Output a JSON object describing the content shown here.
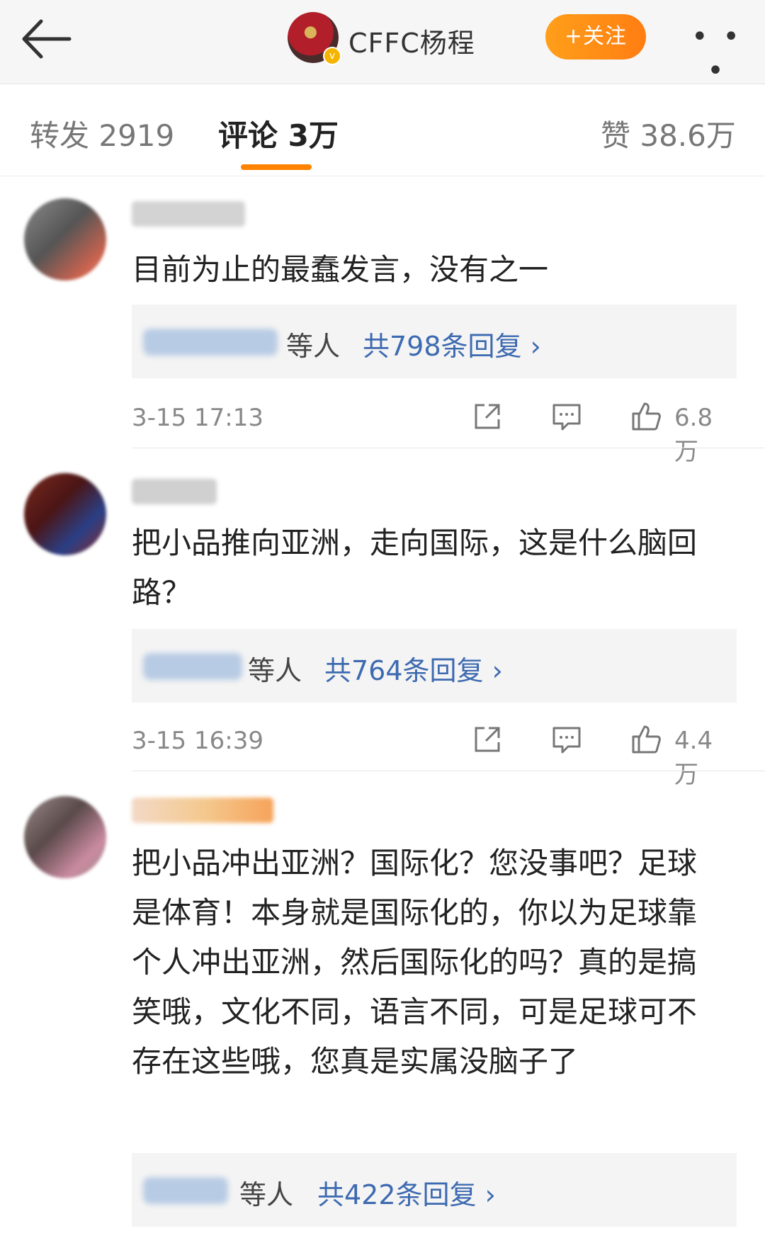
{
  "header": {
    "account_name": "CFFC杨程",
    "follow_label": "+关注",
    "more_label": "• • •"
  },
  "tabs": {
    "repost": "转发 2919",
    "comments": "评论 3万",
    "likes": "赞 38.6万"
  },
  "colors": {
    "accent": "#ff8200",
    "link": "#3d6ab0"
  },
  "comments": [
    {
      "text": "目前为止的最蠢发言，没有之一",
      "reply_suffix": "等人",
      "reply_count_label": "共798条回复 ›",
      "time": "3-15 17:13",
      "likes": "6.8万"
    },
    {
      "text": "把小品推向亚洲，走向国际，这是什么脑回路？",
      "reply_suffix": "等人",
      "reply_count_label": "共764条回复 ›",
      "time": "3-15 16:39",
      "likes": "4.4万"
    },
    {
      "text": "把小品冲出亚洲？国际化？您没事吧？足球是体育！本身就是国际化的，你以为足球靠个人冲出亚洲，然后国际化的吗？真的是搞笑哦，文化不同，语言不同，可是足球可不存在这些哦，您真是实属没脑子了",
      "reply_suffix": "等人",
      "reply_count_label": "共422条回复 ›"
    }
  ]
}
